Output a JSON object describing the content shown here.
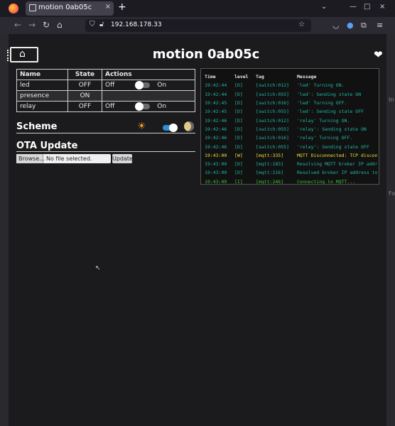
{
  "browser": {
    "tab_title": "motion 0ab05c",
    "tab_close": "×",
    "new_tab": "+",
    "url": "192.168.178.33",
    "win_min": "—",
    "win_max": "□",
    "win_close": "×"
  },
  "page": {
    "title": "motion 0ab05c",
    "heart": "❤"
  },
  "entities": {
    "headers": [
      "Name",
      "State",
      "Actions"
    ],
    "rows": [
      {
        "name": "led",
        "state": "OFF",
        "off": "Off",
        "on": "On"
      },
      {
        "name": "presence",
        "state": "ON"
      },
      {
        "name": "relay",
        "state": "OFF",
        "off": "Off",
        "on": "On"
      }
    ]
  },
  "scheme": {
    "title": "Scheme",
    "sun": "☀",
    "dark_mode": true
  },
  "ota": {
    "title": "OTA Update",
    "browse": "Browse...",
    "no_file": "No file selected.",
    "update": "Update"
  },
  "log": {
    "headers": [
      "Time",
      "level",
      "Tag",
      "Message"
    ],
    "rows": [
      {
        "time": "19:42:44",
        "level": "[D]",
        "tag": "[switch:012]",
        "msg": "'led' Turning ON.",
        "kind": "dbg"
      },
      {
        "time": "19:42:44",
        "level": "[D]",
        "tag": "[switch:055]",
        "msg": "'led': Sending state ON",
        "kind": "dbg"
      },
      {
        "time": "19:42:45",
        "level": "[D]",
        "tag": "[switch:016]",
        "msg": "'led' Turning OFF.",
        "kind": "dbg"
      },
      {
        "time": "19:42:45",
        "level": "[D]",
        "tag": "[switch:055]",
        "msg": "'led': Sending state OFF",
        "kind": "dbg"
      },
      {
        "time": "19:42:46",
        "level": "[D]",
        "tag": "[switch:012]",
        "msg": "'relay' Turning ON.",
        "kind": "dbg"
      },
      {
        "time": "19:42:46",
        "level": "[D]",
        "tag": "[switch:055]",
        "msg": "'relay': Sending state ON",
        "kind": "dbg"
      },
      {
        "time": "19:42:46",
        "level": "[D]",
        "tag": "[switch:016]",
        "msg": "'relay' Turning OFF.",
        "kind": "dbg"
      },
      {
        "time": "19:42:46",
        "level": "[D]",
        "tag": "[switch:055]",
        "msg": "'relay': Sending state OFF",
        "kind": "dbg"
      },
      {
        "time": "19:43:00",
        "level": "[W]",
        "tag": "[mqtt:335]",
        "msg": "MQTT Disconnected: TCP discon",
        "kind": "warn"
      },
      {
        "time": "19:43:00",
        "level": "[D]",
        "tag": "[mqtt:183]",
        "msg": "Resolving MQTT broker IP addr",
        "kind": "dbg"
      },
      {
        "time": "19:43:00",
        "level": "[D]",
        "tag": "[mqtt:216]",
        "msg": "Resolved broker IP address to",
        "kind": "dbg"
      },
      {
        "time": "19:43:00",
        "level": "[I]",
        "tag": "[mqtt:246]",
        "msg": "Connecting to MQTT...",
        "kind": "info"
      }
    ]
  },
  "side": {
    "right_1": "In",
    "right_2": "Fo"
  },
  "colors": {
    "debug": "#1fb8a6",
    "warn": "#e8e33a",
    "info": "#3cc83c",
    "accent": "#2e8fd8"
  }
}
